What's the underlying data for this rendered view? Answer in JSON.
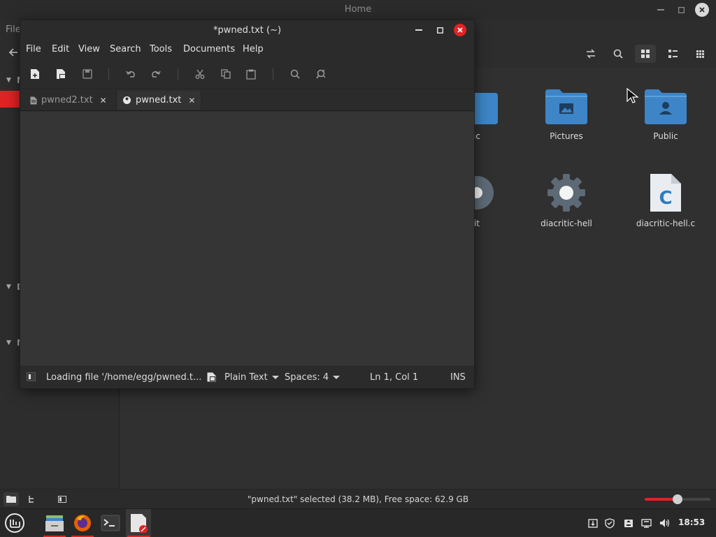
{
  "file_manager": {
    "title": "Home",
    "menu_file": "File",
    "sidebar_letters": [
      "M",
      "D",
      "N"
    ],
    "items": [
      {
        "label": "ic",
        "icon": "folder-public-partial-icon"
      },
      {
        "label": "Pictures",
        "icon": "folder-pictures-icon"
      },
      {
        "label": "Public",
        "icon": "folder-public-icon"
      },
      {
        "label": "it",
        "icon": "gear-partial-icon"
      },
      {
        "label": "diacritic-hell",
        "icon": "executable-gear-icon"
      },
      {
        "label": "diacritic-hell.c",
        "icon": "c-source-file-icon"
      }
    ],
    "status_text": "\"pwned.txt\" selected (38.2 MB), Free space: 62.9 GB",
    "zoom_level": 0.5,
    "colors": {
      "accent": "#e02323",
      "folder": "#3d85c6"
    }
  },
  "editor": {
    "title": "*pwned.txt (~)",
    "menu": [
      "File",
      "Edit",
      "View",
      "Search",
      "Tools",
      "Documents",
      "Help"
    ],
    "tabs": [
      {
        "label": "pwned2.txt",
        "active": false,
        "icon": "document-icon"
      },
      {
        "label": "pwned.txt",
        "active": true,
        "icon": "modified-dot-icon"
      }
    ],
    "status": {
      "message": "Loading file '/home/egg/pwned.t...",
      "language": "Plain Text",
      "spaces": "Spaces: 4",
      "position": "Ln 1, Col 1",
      "mode": "INS"
    }
  },
  "taskbar": {
    "clock": "18:53"
  }
}
